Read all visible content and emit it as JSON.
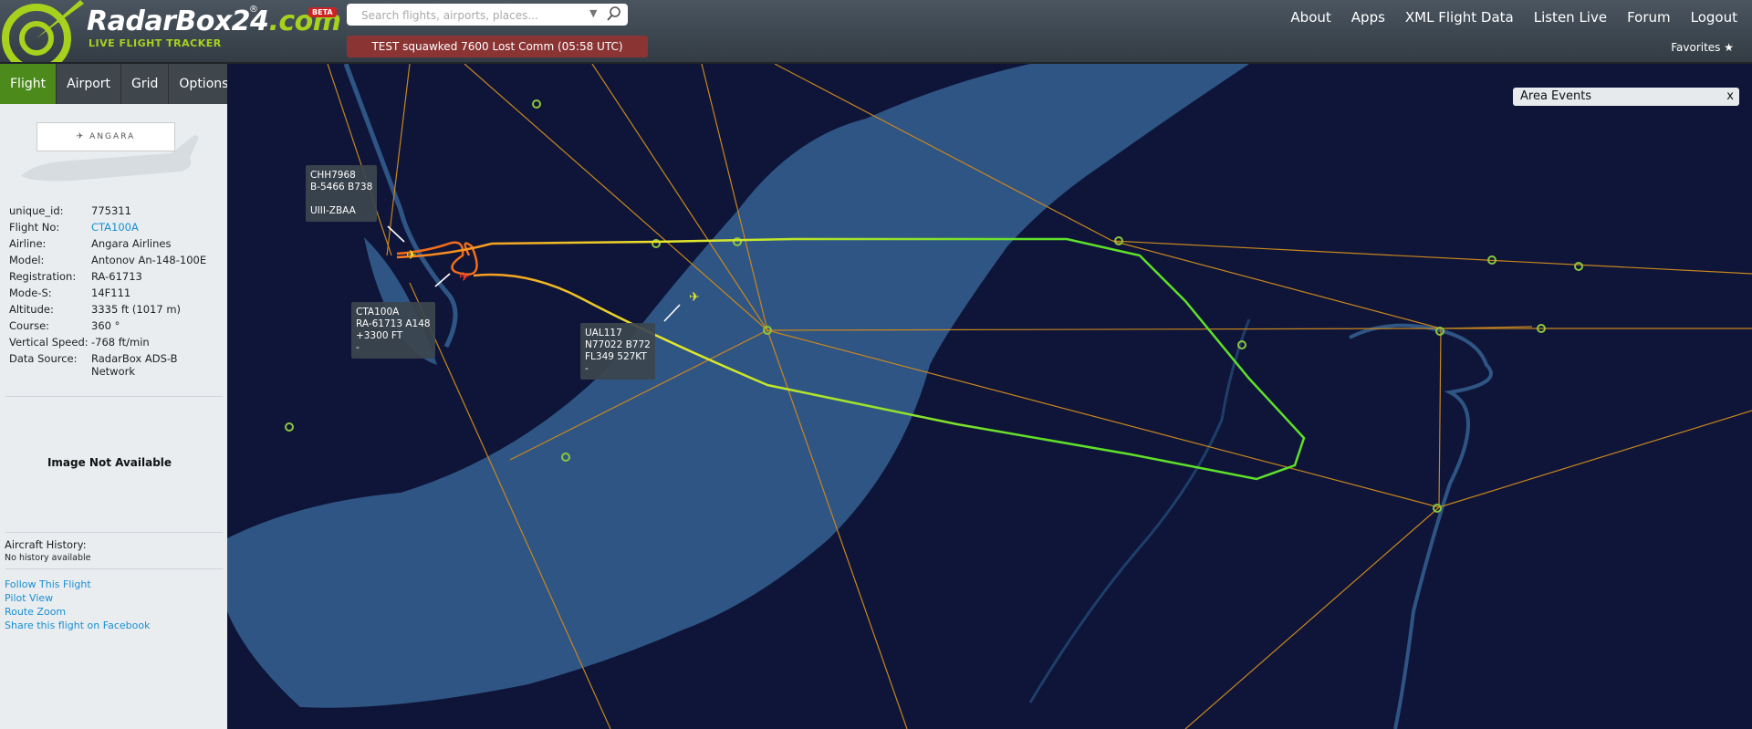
{
  "header": {
    "logo_main": "RadarBox24",
    "logo_suffix": ".com",
    "logo_reg": "®",
    "beta": "BETA",
    "tagline": "LIVE FLIGHT TRACKER",
    "search_placeholder": "Search flights, airports, places...",
    "alert": "TEST squawked 7600 Lost Comm (05:58 UTC)",
    "nav": [
      "About",
      "Apps",
      "XML Flight Data",
      "Listen Live",
      "Forum",
      "Logout"
    ],
    "favorites": "Favorites ★"
  },
  "sidebar": {
    "tabs": [
      "Flight",
      "Airport",
      "Grid",
      "Options"
    ],
    "active_tab": "Flight",
    "fields": [
      {
        "key": "unique_id:",
        "value": "775311"
      },
      {
        "key": "Flight No:",
        "value": "CTA100A"
      },
      {
        "key": "Airline:",
        "value": "Angara Airlines"
      },
      {
        "key": "Model:",
        "value": "Antonov An-148-100E"
      },
      {
        "key": "Registration:",
        "value": "RA-61713"
      },
      {
        "key": "Mode-S:",
        "value": "14F111"
      },
      {
        "key": "Altitude:",
        "value": "3335 ft (1017 m)"
      },
      {
        "key": "Course:",
        "value": "360 °"
      },
      {
        "key": "Vertical Speed:",
        "value": "-768 ft/min"
      },
      {
        "key": "Data Source:",
        "value": "RadarBox ADS-B Network"
      }
    ],
    "image_placeholder": "Image Not Available",
    "history_title": "Aircraft History:",
    "history_value": "No history available",
    "links": [
      "Follow This Flight",
      "Pilot View",
      "Route Zoom",
      "Share this flight on Facebook"
    ]
  },
  "map": {
    "area_events_title": "Area Events",
    "area_events_close": "x",
    "labels": [
      {
        "id": "chh7968",
        "text": "CHH7968\nB-5466 B738\n\nUIII-ZBAA"
      },
      {
        "id": "cta100a",
        "text": "CTA100A\nRA-61713 A148\n+3300 FT\n-"
      },
      {
        "id": "ual117",
        "text": "UAL117\nN77022 B772\nFL349 527KT\n-"
      }
    ]
  },
  "colors": {
    "accent_green": "#a6d21e",
    "alert_red": "#8b3434",
    "tab_active": "#4d8a1c",
    "link_blue": "#1a8fd1",
    "map_land": "#0e1538",
    "map_water": "#2f5585"
  }
}
